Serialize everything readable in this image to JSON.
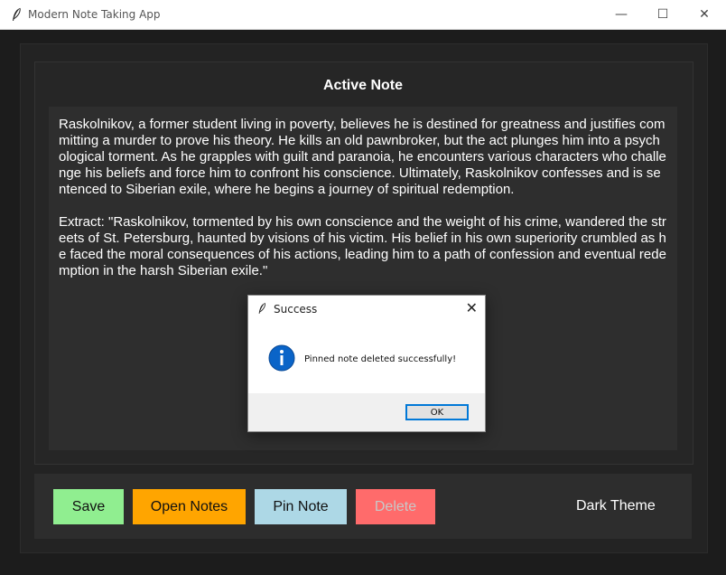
{
  "window": {
    "title": "Modern Note Taking App",
    "minimize": "—",
    "maximize": "☐",
    "close": "✕"
  },
  "note": {
    "heading": "Active Note",
    "paragraph1": "Raskolnikov, a former student living in poverty, believes he is destined for greatness and justifies committing a murder to prove his theory. He kills an old pawnbroker, but the act plunges him into a psychological torment. As he grapples with guilt and paranoia, he encounters various characters who challenge his beliefs and force him to confront his conscience. Ultimately, Raskolnikov confesses and is sentenced to Siberian exile, where he begins a journey of spiritual redemption.",
    "paragraph2": "Extract: \"Raskolnikov, tormented by his own conscience and the weight of his crime, wandered the streets of St. Petersburg, haunted by visions of his victim. His belief in his own superiority crumbled as he faced the moral consequences of his actions, leading him to a path of confession and eventual redemption in the harsh Siberian exile.\""
  },
  "toolbar": {
    "save_label": "Save",
    "open_label": "Open Notes",
    "pin_label": "Pin Note",
    "delete_label": "Delete",
    "theme_label": "Dark Theme"
  },
  "dialog": {
    "title": "Success",
    "close": "✕",
    "message": "Pinned note deleted successfully!",
    "ok_label": "OK"
  },
  "colors": {
    "save": "#90ee90",
    "open": "#ffa500",
    "pin": "#add8e6",
    "delete": "#ff6b6b",
    "info_icon": "#0a64c8"
  }
}
